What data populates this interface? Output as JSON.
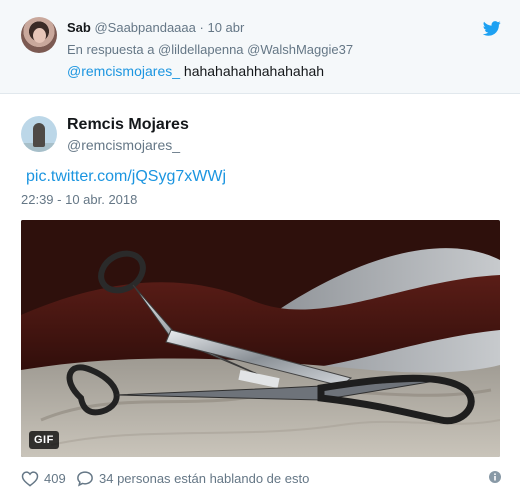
{
  "reply_context": {
    "author_name": "Sab",
    "author_handle": "@Saabpandaaaa",
    "separator": "·",
    "time": "10 abr",
    "reply_label": "En respuesta a @lildellapenna @WalshMaggie37",
    "mention": "@remcismojares_",
    "text": "hahahahahhahahahah"
  },
  "tweet": {
    "author_name": "Remcis Mojares",
    "author_handle": "@remcismojares_",
    "link": "pic.twitter.com/jQSyg7xWWj",
    "timestamp": "22:39 - 10 abr. 2018",
    "media_badge": "GIF"
  },
  "footer": {
    "likes": "409",
    "conversation": "34 personas están hablando de esto"
  },
  "icons": {
    "brand": "twitter-bird-icon",
    "like": "heart-icon",
    "reply": "speech-bubble-icon",
    "info": "info-icon"
  },
  "colors": {
    "link": "#1b95e0",
    "muted": "#657786",
    "text": "#14171a",
    "context_bg": "#f5f8fa"
  }
}
